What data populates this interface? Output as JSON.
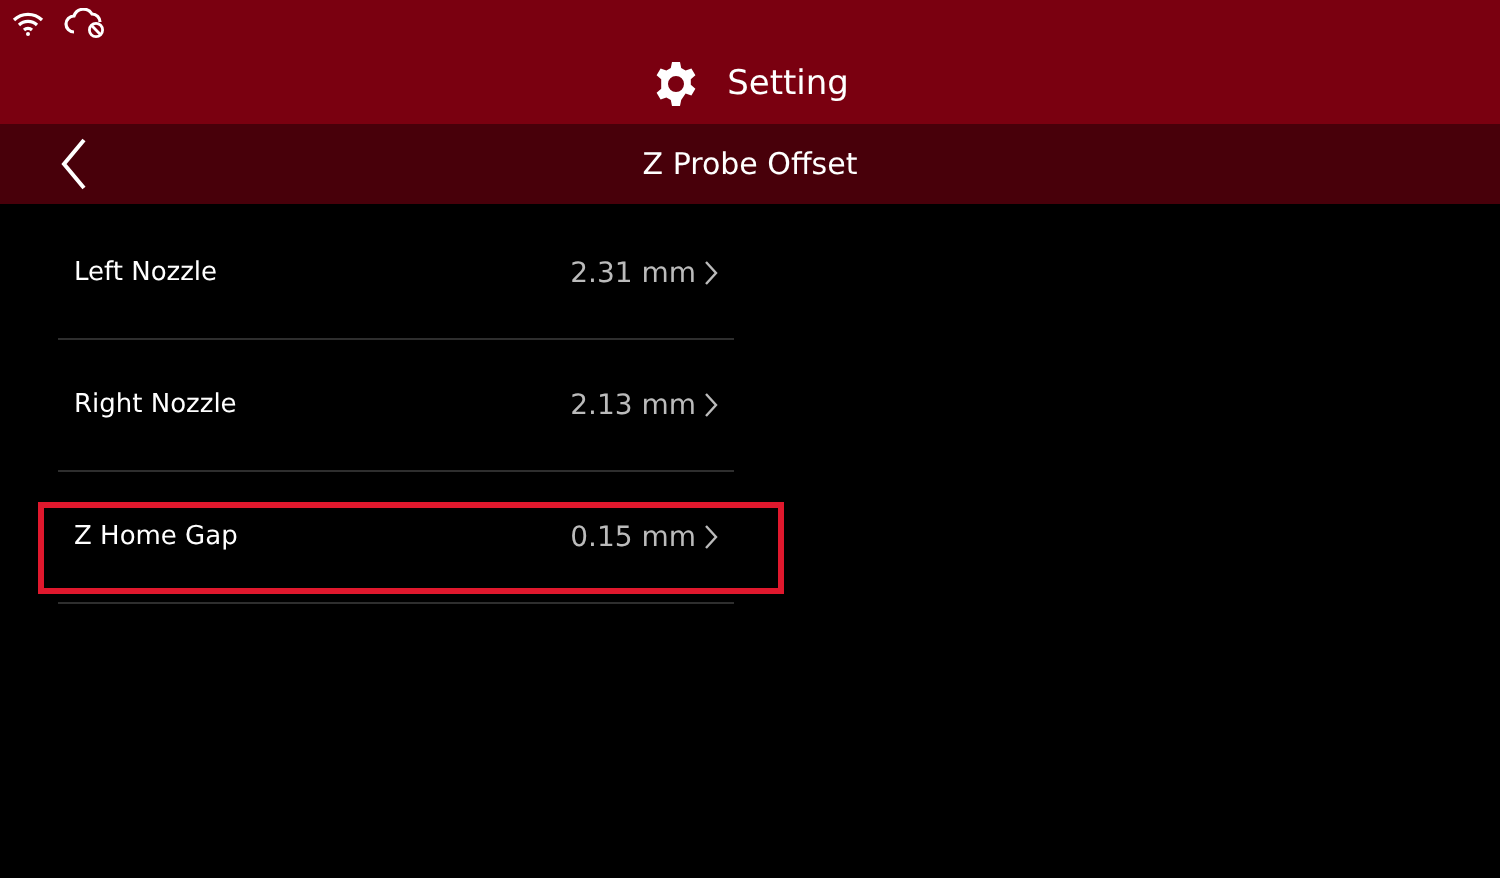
{
  "header": {
    "title": "Setting"
  },
  "subheader": {
    "title": "Z Probe Offset"
  },
  "items": [
    {
      "label": "Left Nozzle",
      "value": "2.31 mm",
      "selected": false
    },
    {
      "label": "Right Nozzle",
      "value": "2.13 mm",
      "selected": false
    },
    {
      "label": "Z Home Gap",
      "value": "0.15 mm",
      "selected": true
    }
  ]
}
